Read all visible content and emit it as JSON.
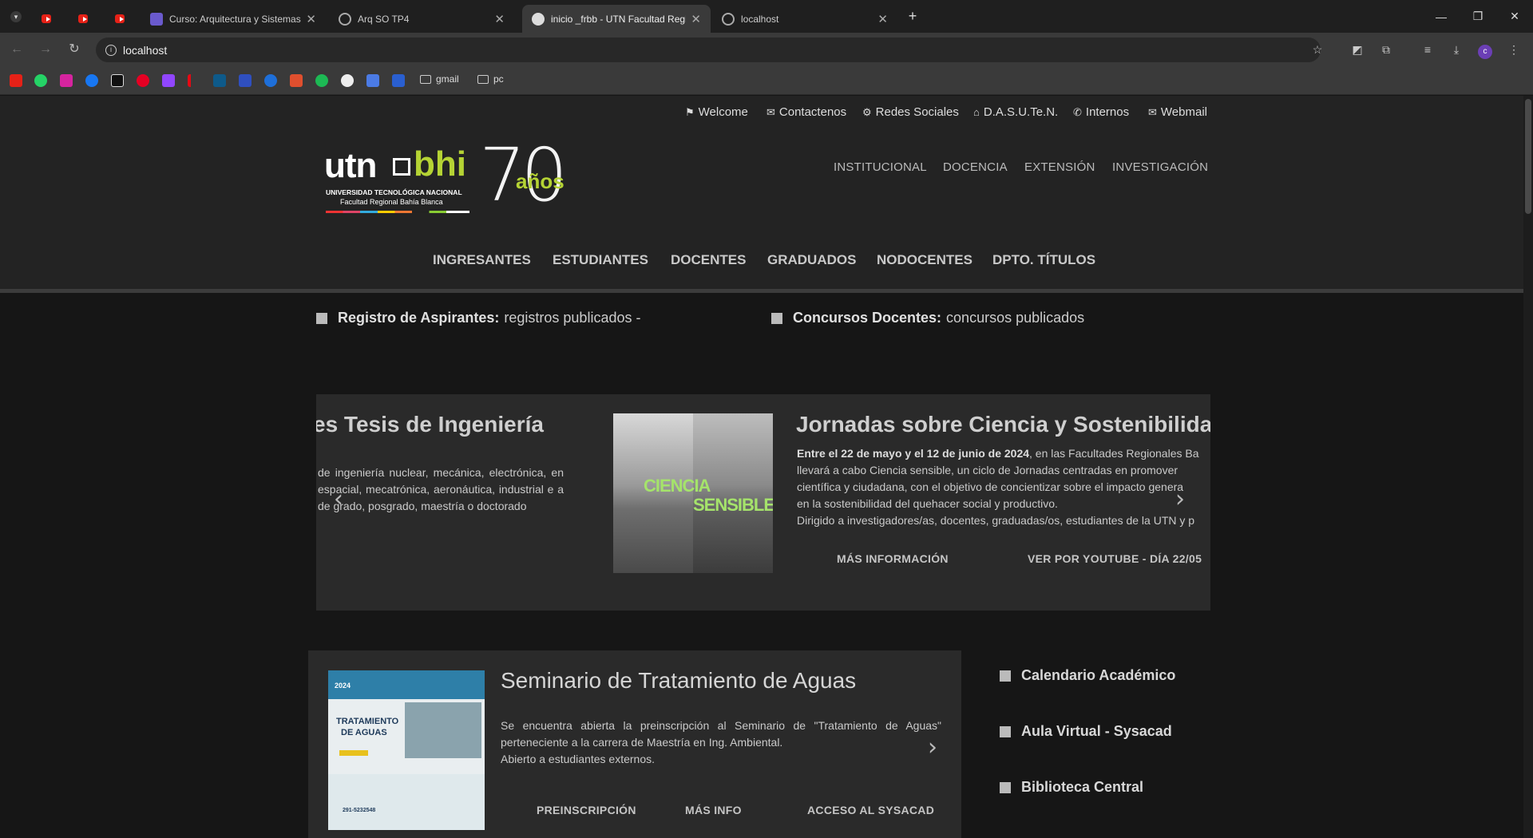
{
  "browser": {
    "tabs": [
      {
        "title": ""
      },
      {
        "title": ""
      },
      {
        "title": ""
      },
      {
        "title": "Curso: Arquitectura y Sistemas Op"
      },
      {
        "title": "Arq SO TP4"
      },
      {
        "title": "inicio _frbb - UTN Facultad Regio"
      },
      {
        "title": "localhost"
      }
    ],
    "new_tab": "+",
    "url": "localhost",
    "bookmark_folders": [
      "gmail",
      "pc"
    ]
  },
  "site": {
    "toplinks": [
      "Welcome",
      "Contactenos",
      "Redes Sociales",
      "D.A.S.U.Te.N.",
      "Internos",
      "Webmail"
    ],
    "logo": {
      "utn": "utn",
      "bhi": "bhi",
      "line1": "UNIVERSIDAD TECNOLÓGICA NACIONAL",
      "line2": "Facultad Regional Bahía Blanca",
      "seventy": "70",
      "anos": "años"
    },
    "main_nav": [
      "INSTITUCIONAL",
      "DOCENCIA",
      "EXTENSIÓN",
      "INVESTIGACIÓN"
    ],
    "section_nav": [
      "INGRESANTES",
      "ESTUDIANTES",
      "DOCENTES",
      "GRADUADOS",
      "NODOCENTES",
      "DPTO. TÍTULOS"
    ],
    "quick_links": [
      {
        "bold": "Registro de Aspirantes:",
        "text": "registros publicados -"
      },
      {
        "bold": "Concursos Docentes:",
        "text": "concursos publicados"
      }
    ],
    "carousel": {
      "prev_slide_title": "es Tesis de Ingeniería",
      "prev_slide_text": "de ingeniería nuclear, mecánica, electrónica, en espacial, mecatrónica, aeronáutica, industrial e a de grado, posgrado, maestría o doctorado",
      "image_words": [
        "CIENCIA",
        "SENSIBLE"
      ],
      "title": "Jornadas sobre Ciencia y Sostenibilidad",
      "date_bold": "Entre el 22 de mayo y el 12 de junio de 2024",
      "text1": ", en las Facultades Regionales Ba",
      "text2": "llevará a cabo Ciencia sensible, un ciclo de Jornadas centradas en promover",
      "text3": "científica y ciudadana, con el objetivo de concientizar sobre el impacto genera",
      "text4": "en la sostenibilidad del quehacer social y productivo.",
      "text5": "Dirigido a investigadores/as, docentes, graduadas/os, estudiantes de la UTN y p",
      "btn1": "MÁS INFORMACIÓN",
      "btn2": "VER POR YOUTUBE - DÍA 22/05"
    },
    "seminar": {
      "title": "Seminario de Tratamiento de Aguas",
      "text1": "Se encuentra abierta la preinscripción al Seminario de \"Tratamiento de Aguas\" perteneciente a la carrera de Maestría en Ing. Ambiental.",
      "text2": "Abierto a estudiantes externos.",
      "btn1": "PREINSCRIPCIÓN",
      "btn2": "MÁS INFO",
      "btn3": "ACCESO AL SYSACAD",
      "poster_title_1": "TRATAMIENTO",
      "poster_title_2": "DE AGUAS",
      "poster_year": "2024",
      "poster_phone": "291-5232548"
    },
    "sidebar_links": [
      "Calendario Académico",
      "Aula Virtual - Sysacad",
      "Biblioteca Central"
    ]
  }
}
